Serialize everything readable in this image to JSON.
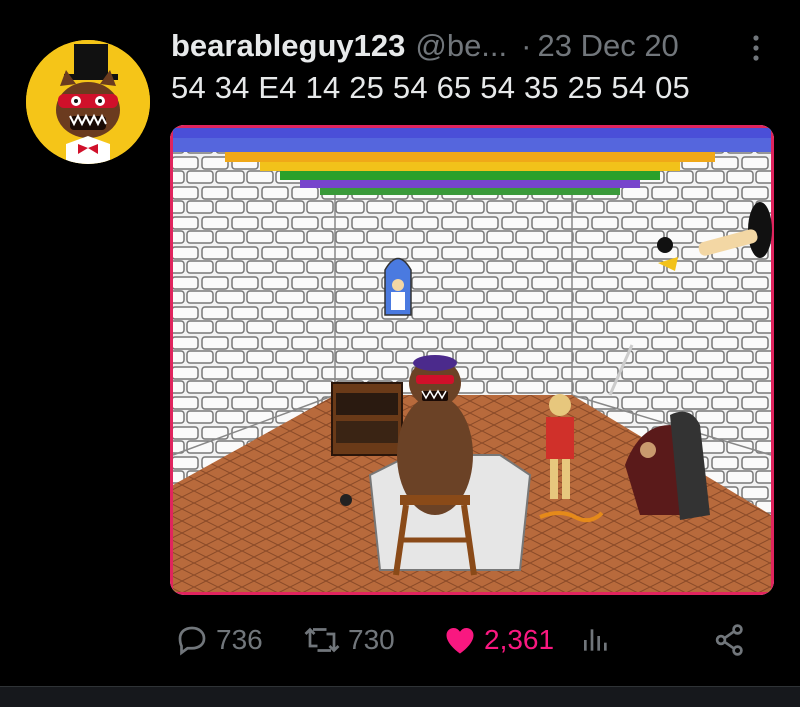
{
  "tweet": {
    "display_name": "bearableguy123",
    "handle": "@be...",
    "separator": "·",
    "date": "23 Dec 20",
    "text": "54 34 E4 14 25 54 65 54 35 25 54 05"
  },
  "actions": {
    "reply_count": "736",
    "retweet_count": "730",
    "like_count": "2,361",
    "icons": [
      "reply-icon",
      "retweet-icon",
      "heart-icon",
      "analytics-icon",
      "share-icon"
    ]
  },
  "colors": {
    "like": "#f91880",
    "muted": "#71767b",
    "avatar_bg": "#f5c518",
    "media_border": "#e0245e"
  }
}
